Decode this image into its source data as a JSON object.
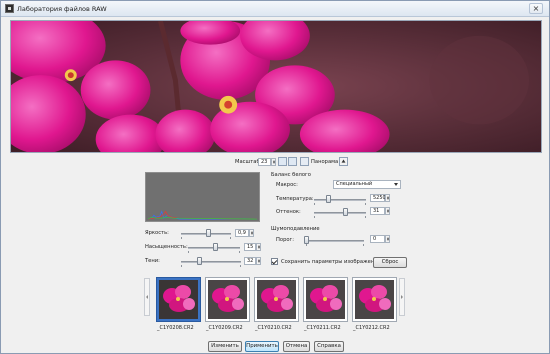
{
  "window": {
    "title": "Лаборатория файлов RAW",
    "close_label": "×"
  },
  "zoom": {
    "label": "Масштаб:",
    "value": "23",
    "panorama_label": "Панорама"
  },
  "white_balance": {
    "group_label": "Баланс белого",
    "preset_label": "Макрос:",
    "preset_value": "Специальный",
    "temperature_label": "Температура:",
    "temperature_value": "5250",
    "temperature_level": 0.28,
    "tint_label": "Оттенок:",
    "tint_value": "31",
    "tint_level": 0.6
  },
  "noise": {
    "group_label": "Шумоподавление",
    "threshold_label": "Порог:",
    "threshold_value": "0",
    "threshold_level": 0.0
  },
  "adjustments": {
    "brightness_label": "Яркость:",
    "brightness_value": "0,9",
    "brightness_level": 0.55,
    "saturation_label": "Насыщенность:",
    "saturation_value": "15",
    "saturation_level": 0.52,
    "shadows_label": "Тени:",
    "shadows_value": "32",
    "shadows_level": 0.3
  },
  "options": {
    "save_params_label": "Сохранить параметры изображения",
    "save_params_checked": true,
    "reset_label": "Сброс"
  },
  "filmstrip": {
    "items": [
      {
        "caption": "_C1Y0208.CR2",
        "selected": true
      },
      {
        "caption": "_C1Y0209.CR2",
        "selected": false
      },
      {
        "caption": "_C1Y0210.CR2",
        "selected": false
      },
      {
        "caption": "_C1Y0211.CR2",
        "selected": false
      },
      {
        "caption": "_C1Y0212.CR2",
        "selected": false
      }
    ]
  },
  "footer": {
    "change_label": "Изменить",
    "apply_label": "Применить",
    "cancel_label": "Отмена",
    "help_label": "Справка"
  },
  "colors": {
    "petal": "#e0178f",
    "petal_light": "#f05bb6",
    "background_dark": "#5a2e3a",
    "selection": "#3b73c4"
  }
}
